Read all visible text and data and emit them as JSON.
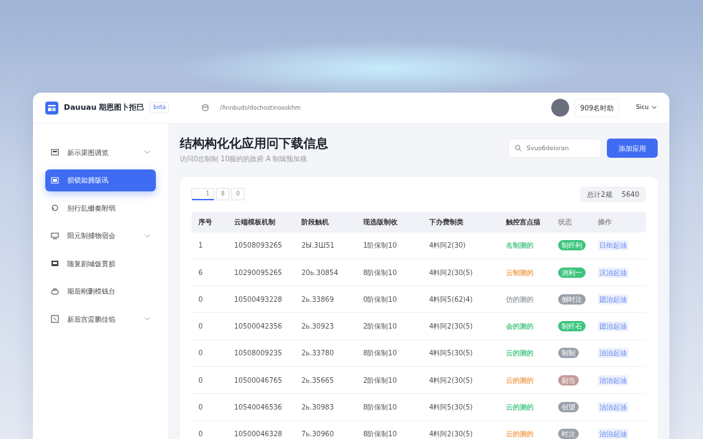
{
  "header": {
    "brand": "Dauuau 期恩图卜拒巳",
    "brand_tag": "beta",
    "breadcrumb": "/Annbuds/dochostinooskhm",
    "user_name": "909名时助",
    "user_menu": "Sicu"
  },
  "sidebar": {
    "items": [
      {
        "label": "新示渠图调览",
        "expandable": true,
        "selected": false
      },
      {
        "label": "损锁如拥版讯",
        "expandable": false,
        "selected": true
      },
      {
        "label": "别行乱缀奏附弱",
        "expandable": false,
        "selected": false
      },
      {
        "label": "阳元制捕物宿会",
        "expandable": true,
        "selected": false
      },
      {
        "label": "随复剧城饭贯损",
        "expandable": false,
        "selected": false
      },
      {
        "label": "期后刚删模钱台",
        "expandable": false,
        "selected": false
      },
      {
        "label": "新后宫蛮鹏佳馅",
        "expandable": true,
        "selected": false
      }
    ]
  },
  "page": {
    "title": "结构构化化应用冋下载信息",
    "subtitle": "访问0总制制 10服的的政府 A 制辑预加规",
    "search": {
      "placeholder": "Svuo6deisran"
    },
    "primary_button": "添加应用"
  },
  "table": {
    "tabs": [
      {
        "label": "1",
        "selected": true
      },
      {
        "label": "8",
        "selected": false
      },
      {
        "label": "0",
        "selected": false
      }
    ],
    "summary": {
      "label": "总计2规",
      "value": "5640"
    },
    "columns": [
      "序号",
      "云端模板机制",
      "阶段触机",
      "现选版制收",
      "下办费制类",
      "触控宫点描",
      "状态",
      "操作"
    ],
    "rows": [
      {
        "cells": [
          "1",
          "10508093265",
          "2Ы.3Ш51",
          "1阶保制10",
          "4料阿2(30)"
        ],
        "status": {
          "text": "名制测的",
          "color": "#52c98a"
        },
        "badge": {
          "label": "制纤利",
          "color": "#3cc47c"
        },
        "action": "日街起油"
      },
      {
        "cells": [
          "6",
          "10290095265",
          "20ь.30854",
          "8阶保制10",
          "4料阿2(30(5)"
        ],
        "status": {
          "text": "云制测的",
          "color": "#f0a860"
        },
        "badge": {
          "label": "浏利一",
          "color": "#3cc47c"
        },
        "action": "汉治起油"
      },
      {
        "cells": [
          "0",
          "10500493228",
          "2ь.33869",
          "0阶保制10",
          "4料阿5(62)4)"
        ],
        "status": {
          "text": "仿的测的",
          "color": "#a6a9b2"
        },
        "badge": {
          "label": "侧时注",
          "color": "#9aa0aa"
        },
        "action": "团治起油"
      },
      {
        "cells": [
          "0",
          "10500042356",
          "2ь.30923",
          "2阶保制10",
          "4料阿2(30(5)"
        ],
        "status": {
          "text": "会的测的",
          "color": "#52c98a"
        },
        "badge": {
          "label": "制纤石",
          "color": "#3cc47c"
        },
        "action": "团治起油"
      },
      {
        "cells": [
          "0",
          "10508009235",
          "2ь.33780",
          "8阶保制10",
          "4料阿5(30(5)"
        ],
        "status": {
          "text": "云的测的",
          "color": "#52c98a"
        },
        "badge": {
          "label": "制制",
          "color": "#9aa0aa"
        },
        "action": "治治起油"
      },
      {
        "cells": [
          "0",
          "10500046765",
          "2ь.35665",
          "2阶保制10",
          "4料阿2(30(5)"
        ],
        "status": {
          "text": "云的测的",
          "color": "#f0a860"
        },
        "badge": {
          "label": "副当",
          "color": "#c49a9a"
        },
        "action": "治治起油"
      },
      {
        "cells": [
          "0",
          "10540046536",
          "2ь.30983",
          "8阶保制10",
          "4料阿5(30(5)"
        ],
        "status": {
          "text": "云的测的",
          "color": "#52c98a"
        },
        "badge": {
          "label": "创望",
          "color": "#9aa0aa"
        },
        "action": "治治起油"
      },
      {
        "cells": [
          "0",
          "10500046328",
          "7ь.30960",
          "8阶保制10",
          "4料阿2(30(5)"
        ],
        "status": {
          "text": "云的测的",
          "color": "#f0a860"
        },
        "badge": {
          "label": "时注",
          "color": "#9aa0aa"
        },
        "action": "治治起油"
      }
    ]
  }
}
